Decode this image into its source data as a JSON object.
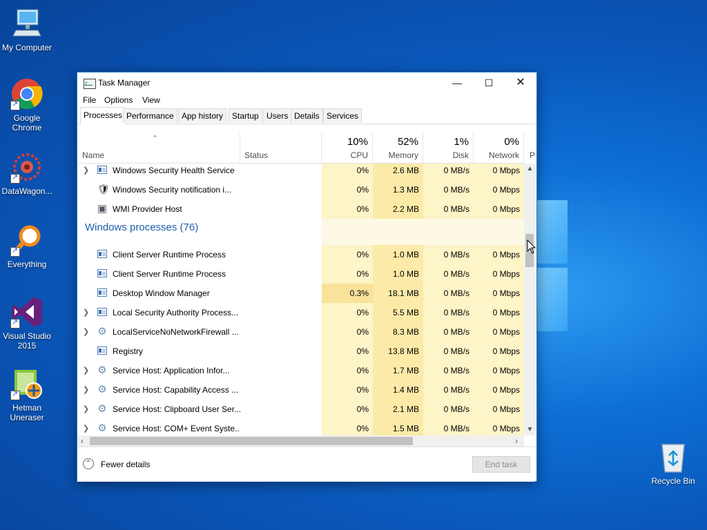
{
  "desktop": {
    "icons": [
      {
        "label": "My Computer",
        "icon": "computer-icon"
      },
      {
        "label": "Google Chrome",
        "icon": "chrome-icon"
      },
      {
        "label": "DataWagon...",
        "icon": "datawagon-icon"
      },
      {
        "label": "Everything",
        "icon": "search-magnifier-icon"
      },
      {
        "label": "Visual Studio 2015",
        "icon": "visual-studio-icon"
      },
      {
        "label": "Hetman Uneraser",
        "icon": "uneraser-icon"
      }
    ],
    "recycle_bin": {
      "label": "Recycle Bin",
      "icon": "recycle-bin-icon"
    }
  },
  "window": {
    "title": "Task Manager",
    "menu": [
      "File",
      "Options",
      "View"
    ],
    "tabs": [
      "Processes",
      "Performance",
      "App history",
      "Startup",
      "Users",
      "Details",
      "Services"
    ],
    "active_tab": "Processes",
    "columns": {
      "name": "Name",
      "status": "Status",
      "cpu": {
        "pct": "10%",
        "label": "CPU"
      },
      "memory": {
        "pct": "52%",
        "label": "Memory"
      },
      "disk": {
        "pct": "1%",
        "label": "Disk"
      },
      "network": {
        "pct": "0%",
        "label": "Network"
      },
      "partial": "P"
    },
    "rows_top": [
      {
        "name": "Windows Security Health Service",
        "cpu": "0%",
        "mem": "2.6 MB",
        "disk": "0 MB/s",
        "net": "0 Mbps",
        "expand": true,
        "icon": "process"
      },
      {
        "name": "Windows Security notification i...",
        "cpu": "0%",
        "mem": "1.3 MB",
        "disk": "0 MB/s",
        "net": "0 Mbps",
        "expand": false,
        "icon": "shield"
      },
      {
        "name": "WMI Provider Host",
        "cpu": "0%",
        "mem": "2.2 MB",
        "disk": "0 MB/s",
        "net": "0 Mbps",
        "expand": false,
        "icon": "wmi"
      }
    ],
    "group": {
      "title": "Windows processes (76)"
    },
    "rows": [
      {
        "name": "Client Server Runtime Process",
        "cpu": "0%",
        "mem": "1.0 MB",
        "disk": "0 MB/s",
        "net": "0 Mbps",
        "expand": false,
        "icon": "process"
      },
      {
        "name": "Client Server Runtime Process",
        "cpu": "0%",
        "mem": "1.0 MB",
        "disk": "0 MB/s",
        "net": "0 Mbps",
        "expand": false,
        "icon": "process"
      },
      {
        "name": "Desktop Window Manager",
        "cpu": "0.3%",
        "mem": "18.1 MB",
        "disk": "0 MB/s",
        "net": "0 Mbps",
        "expand": false,
        "icon": "process"
      },
      {
        "name": "Local Security Authority Process...",
        "cpu": "0%",
        "mem": "5.5 MB",
        "disk": "0 MB/s",
        "net": "0 Mbps",
        "expand": true,
        "icon": "process"
      },
      {
        "name": "LocalServiceNoNetworkFirewall ...",
        "cpu": "0%",
        "mem": "8.3 MB",
        "disk": "0 MB/s",
        "net": "0 Mbps",
        "expand": true,
        "icon": "gear"
      },
      {
        "name": "Registry",
        "cpu": "0%",
        "mem": "13.8 MB",
        "disk": "0 MB/s",
        "net": "0 Mbps",
        "expand": false,
        "icon": "process"
      },
      {
        "name": "Service Host: Application Infor...",
        "cpu": "0%",
        "mem": "1.7 MB",
        "disk": "0 MB/s",
        "net": "0 Mbps",
        "expand": true,
        "icon": "gear"
      },
      {
        "name": "Service Host: Capability Access ...",
        "cpu": "0%",
        "mem": "1.4 MB",
        "disk": "0 MB/s",
        "net": "0 Mbps",
        "expand": true,
        "icon": "gear"
      },
      {
        "name": "Service Host: Clipboard User Ser...",
        "cpu": "0%",
        "mem": "2.1 MB",
        "disk": "0 MB/s",
        "net": "0 Mbps",
        "expand": true,
        "icon": "gear"
      },
      {
        "name": "Service Host: COM+ Event Syste...",
        "cpu": "0%",
        "mem": "1.5 MB",
        "disk": "0 MB/s",
        "net": "0 Mbps",
        "expand": true,
        "icon": "gear"
      }
    ],
    "footer": {
      "fewer_details": "Fewer details",
      "end_task": "End task"
    }
  }
}
